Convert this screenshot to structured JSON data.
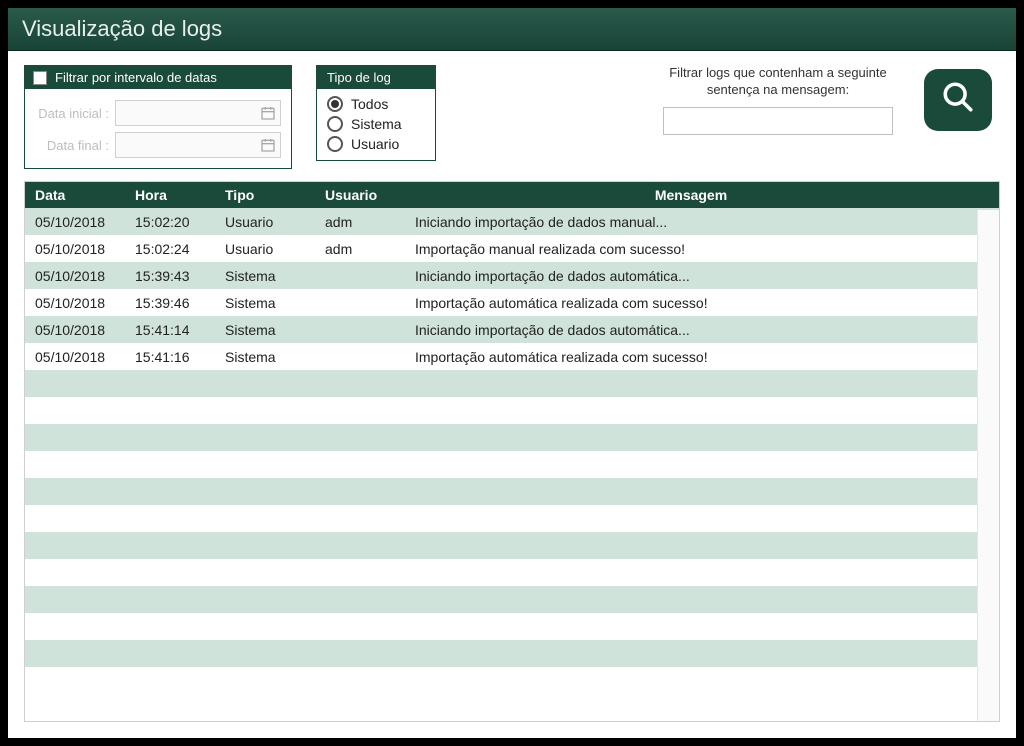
{
  "title": "Visualização de logs",
  "dateFilter": {
    "header": "Filtrar por intervalo de datas",
    "startLabel": "Data inicial :",
    "endLabel": "Data final :",
    "startValue": "",
    "endValue": "",
    "enabled": false
  },
  "typeFilter": {
    "header": "Tipo de log",
    "options": [
      "Todos",
      "Sistema",
      "Usuario"
    ],
    "selected": "Todos"
  },
  "search": {
    "label": "Filtrar logs que contenham a seguinte sentença na mensagem:",
    "value": ""
  },
  "table": {
    "headers": {
      "data": "Data",
      "hora": "Hora",
      "tipo": "Tipo",
      "usuario": "Usuario",
      "mensagem": "Mensagem"
    },
    "rows": [
      {
        "data": "05/10/2018",
        "hora": "15:02:20",
        "tipo": "Usuario",
        "usuario": "adm",
        "mensagem": "Iniciando importação de dados manual..."
      },
      {
        "data": "05/10/2018",
        "hora": "15:02:24",
        "tipo": "Usuario",
        "usuario": "adm",
        "mensagem": "Importação manual realizada com sucesso!"
      },
      {
        "data": "05/10/2018",
        "hora": "15:39:43",
        "tipo": "Sistema",
        "usuario": "",
        "mensagem": "Iniciando importação de dados automática..."
      },
      {
        "data": "05/10/2018",
        "hora": "15:39:46",
        "tipo": "Sistema",
        "usuario": "",
        "mensagem": "Importação automática realizada com sucesso!"
      },
      {
        "data": "05/10/2018",
        "hora": "15:41:14",
        "tipo": "Sistema",
        "usuario": "",
        "mensagem": "Iniciando importação de dados automática..."
      },
      {
        "data": "05/10/2018",
        "hora": "15:41:16",
        "tipo": "Sistema",
        "usuario": "",
        "mensagem": "Importação automática realizada com sucesso!"
      }
    ],
    "emptyRows": 12
  }
}
